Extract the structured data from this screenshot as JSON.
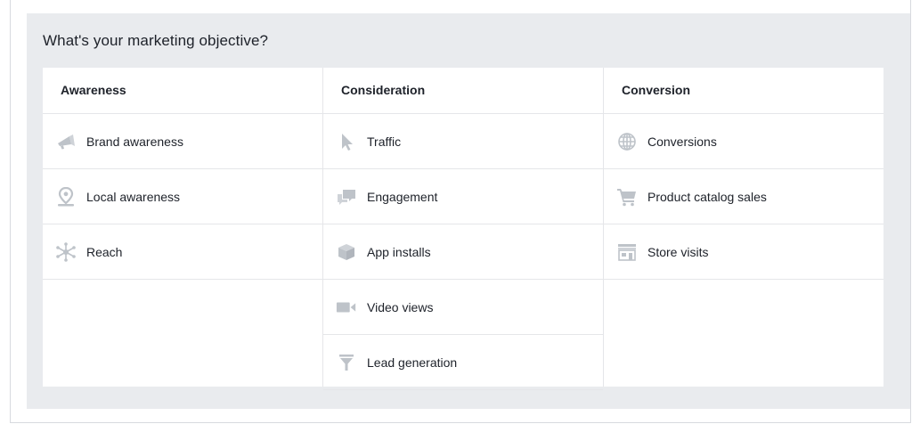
{
  "question": "What's your marketing objective?",
  "columns": [
    {
      "title": "Awareness",
      "items": [
        {
          "label": "Brand awareness",
          "icon": "megaphone-icon"
        },
        {
          "label": "Local awareness",
          "icon": "location-pin-icon"
        },
        {
          "label": "Reach",
          "icon": "network-reach-icon"
        }
      ]
    },
    {
      "title": "Consideration",
      "items": [
        {
          "label": "Traffic",
          "icon": "cursor-arrow-icon"
        },
        {
          "label": "Engagement",
          "icon": "chat-bubbles-icon"
        },
        {
          "label": "App installs",
          "icon": "box-icon"
        },
        {
          "label": "Video views",
          "icon": "video-camera-icon"
        },
        {
          "label": "Lead generation",
          "icon": "funnel-icon"
        }
      ]
    },
    {
      "title": "Conversion",
      "items": [
        {
          "label": "Conversions",
          "icon": "globe-icon"
        },
        {
          "label": "Product catalog sales",
          "icon": "shopping-cart-icon"
        },
        {
          "label": "Store visits",
          "icon": "storefront-icon"
        }
      ]
    }
  ],
  "colors": {
    "panel_background": "#e9ebee",
    "icon": "#bec3c9",
    "text": "#1d2129",
    "divider": "#e5e6e9"
  }
}
